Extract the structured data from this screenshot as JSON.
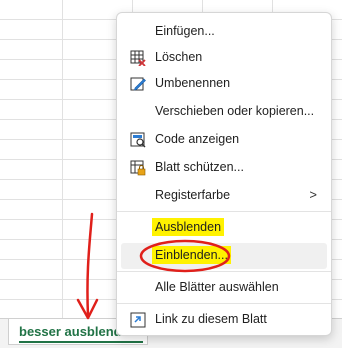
{
  "sheet_tab": {
    "name": "besser ausblenden"
  },
  "add_sheet": {
    "label": "+"
  },
  "context_menu": {
    "items": [
      {
        "label": "Einfügen..."
      },
      {
        "label": "Löschen"
      },
      {
        "label": "Umbenennen"
      },
      {
        "label": "Verschieben oder kopieren..."
      },
      {
        "label": "Code anzeigen"
      },
      {
        "label": "Blatt schützen..."
      },
      {
        "label": "Registerfarbe"
      },
      {
        "label": "Ausblenden"
      },
      {
        "label": "Einblenden..."
      },
      {
        "label": "Alle Blätter auswählen"
      },
      {
        "label": "Link zu diesem Blatt"
      }
    ],
    "submenu_arrow": ">"
  },
  "colors": {
    "highlight": "#fff200",
    "annotation_red": "#e0201b",
    "tab_text": "#217346"
  },
  "icons": [
    "table-icon",
    "delete-table-icon",
    "rename-icon",
    "code-icon",
    "protect-sheet-icon",
    "link-icon"
  ]
}
